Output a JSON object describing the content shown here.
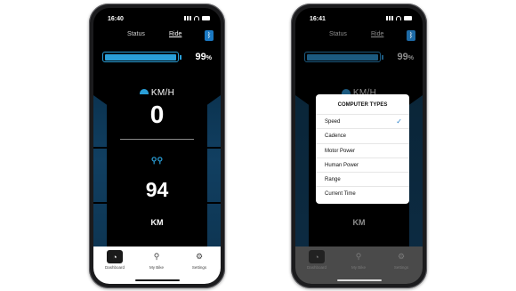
{
  "phone1": {
    "time": "16:40",
    "tabs": [
      "Status",
      "Ride"
    ],
    "bt_icon": "bluetooth-icon",
    "battery_percent": "99",
    "battery_unit": "%",
    "battery_level": 0.99,
    "speed_label": "KM/H",
    "speed_value": "0",
    "range_icon": "range-icon",
    "range_value": "94",
    "range_unit": "KM",
    "nav": [
      "Dashboard",
      "My Bike",
      "Settings"
    ]
  },
  "phone2": {
    "time": "16:41",
    "tabs": [
      "Status",
      "Ride"
    ],
    "battery_percent": "99",
    "battery_unit": "%",
    "battery_level": 0.99,
    "speed_label": "KM/H",
    "range_unit": "KM",
    "nav": [
      "Dashboard",
      "My Bike",
      "Settings"
    ],
    "popup": {
      "title": "COMPUTER TYPES",
      "options": [
        "Speed",
        "Cadence",
        "Motor Power",
        "Human Power",
        "Range",
        "Current Time"
      ],
      "selected": "Speed"
    }
  },
  "colors": {
    "accent": "#2a9fd8",
    "side_panel": "#113f61"
  }
}
